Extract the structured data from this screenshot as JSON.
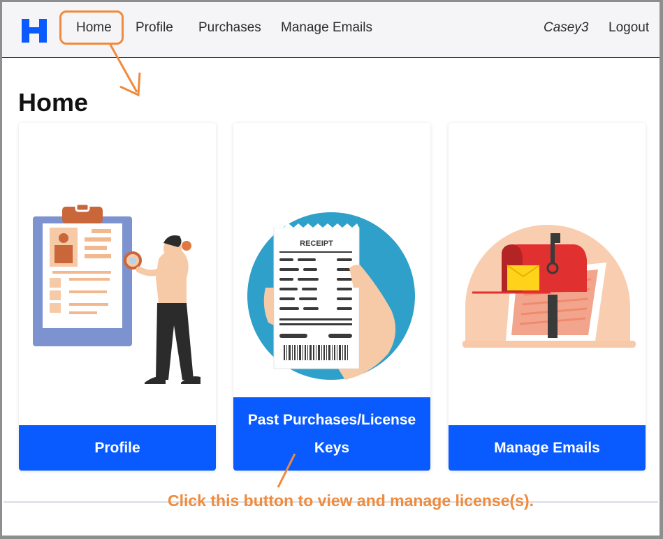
{
  "navbar": {
    "logo_letter": "H",
    "links": [
      {
        "label": "Home"
      },
      {
        "label": "Profile"
      },
      {
        "label": "Purchases"
      },
      {
        "label": "Manage Emails"
      }
    ],
    "username": "Casey3",
    "logout_label": "Logout"
  },
  "page": {
    "title": "Home"
  },
  "cards": [
    {
      "button_label": "Profile",
      "illustration": "clipboard-profile-illustration"
    },
    {
      "button_label_line1": "Past Purchases/License",
      "button_label_line2": "Keys",
      "illustration": "receipt-illustration",
      "receipt_text": "RECEIPT"
    },
    {
      "button_label": "Manage Emails",
      "illustration": "mailbox-illustration"
    }
  ],
  "annotation": {
    "text": "Click this button to view and manage license(s).",
    "color": "#f08a3c"
  },
  "colors": {
    "accent": "#0a5bff",
    "nav_bg": "#f5f5f7"
  }
}
